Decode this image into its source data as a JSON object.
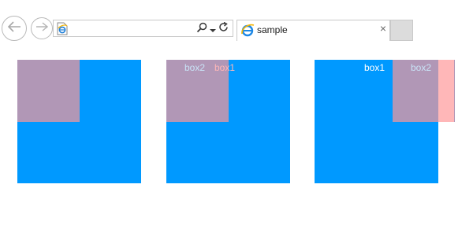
{
  "browser": {
    "address_value": "",
    "tab_title": "sample",
    "tab_close": "×"
  },
  "page": {
    "demo2": {
      "label_box2": "box2",
      "label_box1": "box1"
    },
    "demo3": {
      "label_box1": "box1",
      "label_box2": "box2"
    }
  },
  "colors": {
    "box_blue": "#0099ff",
    "box_purple": "#b197b6",
    "box_pink": "#ffb7b8",
    "label_light_blue": "#c9e3f7",
    "label_pink": "#ffb7b8",
    "label_white": "#ffffff"
  },
  "icons": [
    "back-arrow-icon",
    "forward-arrow-icon",
    "page-icon",
    "search-icon",
    "dropdown-arrow-icon",
    "refresh-icon",
    "ie-logo-icon",
    "close-icon"
  ]
}
